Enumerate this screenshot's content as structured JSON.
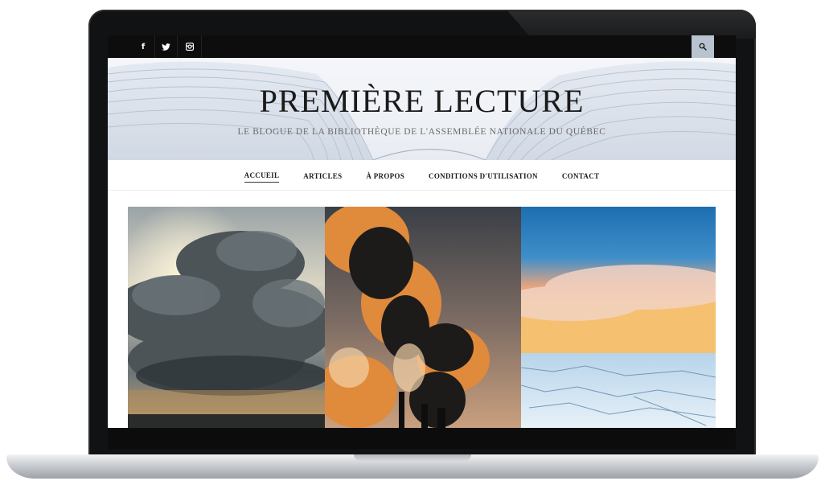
{
  "topbar": {
    "social": [
      {
        "icon": "facebook-icon",
        "glyph": "f"
      },
      {
        "icon": "twitter-icon",
        "glyph": "🐦"
      },
      {
        "icon": "instagram-icon",
        "glyph": "◙"
      }
    ],
    "search_icon": "search-icon"
  },
  "header": {
    "title": "PREMIÈRE LECTURE",
    "tagline": "LE BLOGUE DE LA BIBLIOTHÈQUE DE L'ASSEMBLÉE NATIONALE DU QUÉBEC"
  },
  "nav": {
    "items": [
      {
        "label": "ACCUEIL",
        "active": true
      },
      {
        "label": "ARTICLES",
        "active": false
      },
      {
        "label": "À PROPOS",
        "active": false
      },
      {
        "label": "CONDITIONS D'UTILISATION",
        "active": false
      },
      {
        "label": "CONTACT",
        "active": false
      }
    ]
  },
  "hero": {
    "images": [
      "storm-clouds-image",
      "smokestacks-image",
      "arctic-ice-image"
    ]
  },
  "colors": {
    "topbar": "#0d0d0e",
    "search_button": "#b9c3cf",
    "title_text": "#1a1a1a"
  }
}
